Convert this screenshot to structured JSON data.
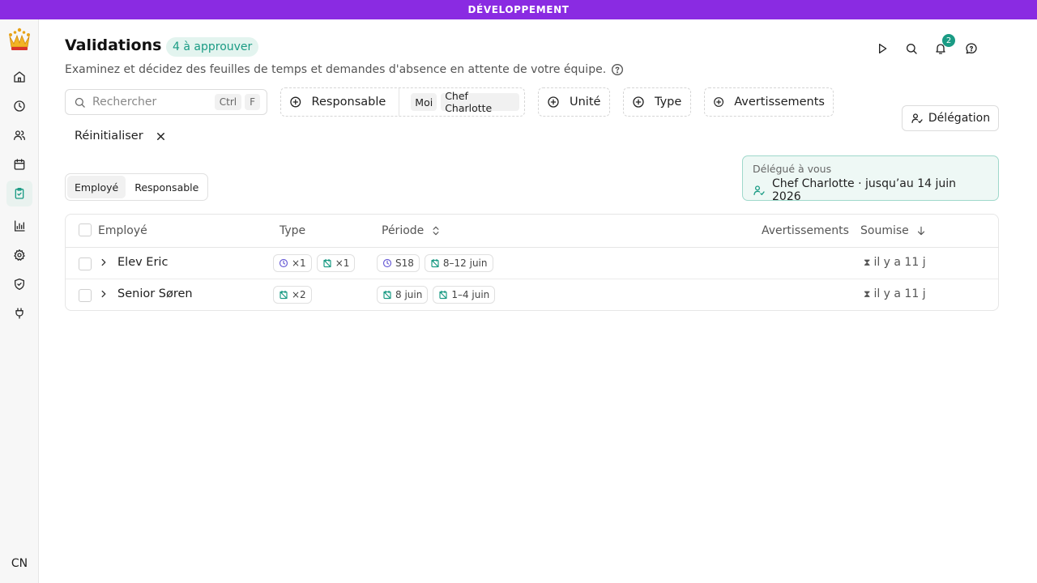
{
  "env_banner": "DÉVELOPPEMENT",
  "sidebar": {
    "items": [
      {
        "name": "home",
        "icon": "home-icon"
      },
      {
        "name": "timesheets",
        "icon": "clock-icon"
      },
      {
        "name": "team",
        "icon": "users-icon"
      },
      {
        "name": "calendar",
        "icon": "calendar-icon"
      },
      {
        "name": "validations",
        "icon": "clipboard-check-icon",
        "active": true
      },
      {
        "name": "reports",
        "icon": "bar-chart-icon"
      },
      {
        "name": "settings",
        "icon": "gear-icon"
      },
      {
        "name": "security",
        "icon": "shield-icon"
      },
      {
        "name": "integrations",
        "icon": "plug-icon"
      }
    ],
    "user_initials": "CN"
  },
  "header": {
    "title": "Validations",
    "pending_badge": "4 à approuver",
    "subtitle": "Examinez et décidez des feuilles de temps et demandes d'absence en attente de votre équipe.",
    "notifications_count": "2"
  },
  "filters": {
    "search_placeholder": "Rechercher",
    "shortcut_keys": [
      "Ctrl",
      "F"
    ],
    "manager_label": "Responsable",
    "manager_chips": [
      "Moi",
      "Chef Charlotte"
    ],
    "unit_label": "Unité",
    "type_label": "Type",
    "warnings_label": "Avertissements",
    "reset_label": "Réinitialiser"
  },
  "delegation_button": "Délégation",
  "view_toggle": {
    "options": [
      "Employé",
      "Responsable"
    ],
    "selected": "Employé"
  },
  "delegated": {
    "label": "Délégué à vous",
    "text": "Chef Charlotte · jusqu’au 14 juin 2026"
  },
  "table": {
    "columns": {
      "employee": "Employé",
      "type": "Type",
      "period": "Période",
      "warnings": "Avertissements",
      "submitted": "Soumise"
    },
    "rows": [
      {
        "name": "Elev Eric",
        "types": [
          {
            "icon": "clock-icon",
            "label": "×1"
          },
          {
            "icon": "absence-icon",
            "label": "×1"
          }
        ],
        "periods": [
          {
            "icon": "clock-icon",
            "label": "S18"
          },
          {
            "icon": "absence-icon",
            "label": "8–12 juin"
          }
        ],
        "submitted": "il y a 11 j"
      },
      {
        "name": "Senior Søren",
        "types": [
          {
            "icon": "absence-icon",
            "label": "×2"
          }
        ],
        "periods": [
          {
            "icon": "absence-icon",
            "label": "8 juin"
          },
          {
            "icon": "absence-icon",
            "label": "1–4 juin"
          }
        ],
        "submitted": "il y a 11 j"
      }
    ]
  },
  "colors": {
    "banner": "#8a2be2",
    "accent": "#1a9b84",
    "timesheet_icon": "#6b5fd6",
    "absence_icon": "#1a9b84"
  }
}
